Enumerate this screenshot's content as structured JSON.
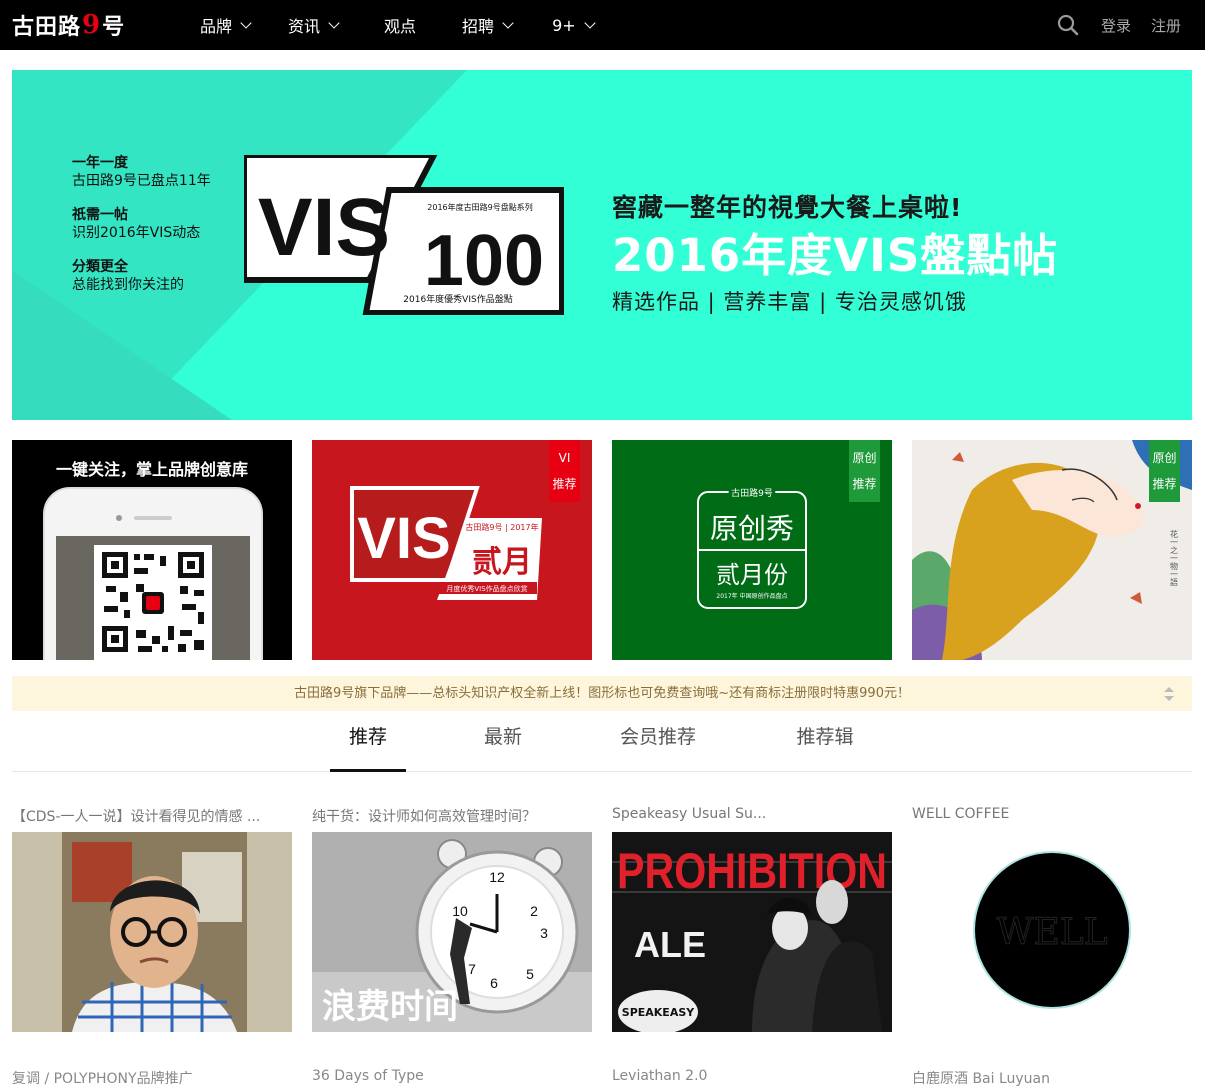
{
  "header": {
    "logo_text_a": "古田路",
    "logo_text_nine": "9",
    "logo_text_b": "号",
    "nav": [
      {
        "label": "品牌",
        "has_dropdown": true
      },
      {
        "label": "资讯",
        "has_dropdown": true
      },
      {
        "label": "观点",
        "has_dropdown": false
      },
      {
        "label": "招聘",
        "has_dropdown": true
      },
      {
        "label": "9+",
        "has_dropdown": true
      }
    ],
    "login": "登录",
    "register": "注册"
  },
  "banner": {
    "left_lines": [
      {
        "head": "一年一度",
        "body": "古田路9号已盘点11年"
      },
      {
        "head": "祇需一帖",
        "body": "识别2016年VIS动态"
      },
      {
        "head": "分類更全",
        "body": "总能找到你关注的"
      }
    ],
    "badge_vis": "VIS",
    "badge_100": "100",
    "badge_top": "2016年度古田路9号盘點系列",
    "badge_bottom": "2016年度優秀VIS作品盤點",
    "tagline": "窖藏一整年的視覺大餐上桌啦!",
    "title": "2016年度VIS盤點帖",
    "subtitle": "精选作品 | 营养丰富 | 专治灵感饥饿",
    "accent_color": "#33ffd6"
  },
  "tiles": {
    "t1_caption": "一键关注，掌上品牌创意库",
    "t2_vis": "VIS",
    "t2_month": "贰月",
    "t2_brand": "古田路9号 | 2017年",
    "t2_sub": "月度优秀VIS作品盘点欣赏",
    "t2_ribbon_top": "VI",
    "t2_ribbon_bottom": "推荐",
    "t3_brand": "古田路9号",
    "t3_line1": "原创秀",
    "t3_line2": "贰月份",
    "t3_small": "2017年 中国原创作品盘点",
    "t3_ribbon_top": "原创",
    "t3_ribbon_bottom": "推荐",
    "t4_ribbon_top": "原创",
    "t4_ribbon_bottom": "推荐",
    "t4_side": "花一之一物一語"
  },
  "notice": "古田路9号旗下品牌——总标头知识产权全新上线！图形标也可免费查询哦~还有商标注册限时特惠990元！",
  "tabs": [
    "推荐",
    "最新",
    "会员推荐",
    "推荐辑"
  ],
  "cards": [
    {
      "title": "【CDS-一人一说】设计看得见的情感 ..."
    },
    {
      "title": "纯干货：设计师如何高效管理时间？",
      "overlay": "浪费时间"
    },
    {
      "title": "Speakeasy Usual Su...",
      "poster_top": "PROHIBITION",
      "poster_mid": "ALE",
      "poster_badge": "SPEAKEASY"
    },
    {
      "title": "WELL COFFEE",
      "logo": "WELL"
    }
  ],
  "row2": [
    "复调 / POLYPHONY品牌推广",
    "36 Days of Type",
    "Leviathan 2.0",
    "白鹿原酒 Bai Luyuan"
  ]
}
